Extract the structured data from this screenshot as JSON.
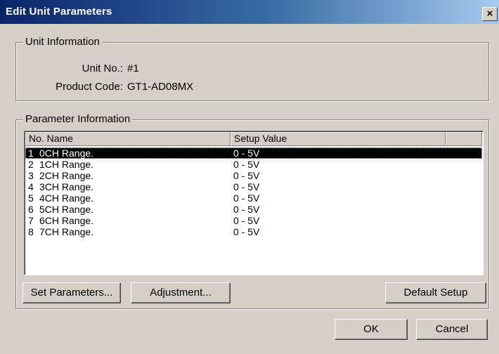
{
  "window": {
    "title": "Edit Unit Parameters",
    "close_glyph": "×"
  },
  "unit_info": {
    "title": "Unit Information",
    "unit_no_label": "Unit No.:",
    "unit_no_value": "#1",
    "product_code_label": "Product Code:",
    "product_code_value": "GT1-AD08MX"
  },
  "param_info": {
    "title": "Parameter Information",
    "columns": [
      "No. Name",
      "Setup Value",
      ""
    ],
    "rows": [
      {
        "no": "1",
        "name": "0CH Range.",
        "value": "0 - 5V",
        "selected": true
      },
      {
        "no": "2",
        "name": "1CH Range.",
        "value": "0 - 5V"
      },
      {
        "no": "3",
        "name": "2CH Range.",
        "value": "0 - 5V"
      },
      {
        "no": "4",
        "name": "3CH Range.",
        "value": "0 - 5V"
      },
      {
        "no": "5",
        "name": "4CH Range.",
        "value": "0 - 5V"
      },
      {
        "no": "6",
        "name": "5CH Range.",
        "value": "0 - 5V"
      },
      {
        "no": "7",
        "name": "6CH Range.",
        "value": "0 - 5V"
      },
      {
        "no": "8",
        "name": "7CH Range.",
        "value": "0 - 5V"
      }
    ]
  },
  "buttons": {
    "set_parameters": "Set Parameters...",
    "adjustment": "Adjustment...",
    "default_setup": "Default Setup",
    "ok": "OK",
    "cancel": "Cancel"
  },
  "colors": {
    "titlebar_start": "#0a246a",
    "titlebar_end": "#a6caf0",
    "face": "#d4d0c8",
    "selection": "#000000"
  }
}
